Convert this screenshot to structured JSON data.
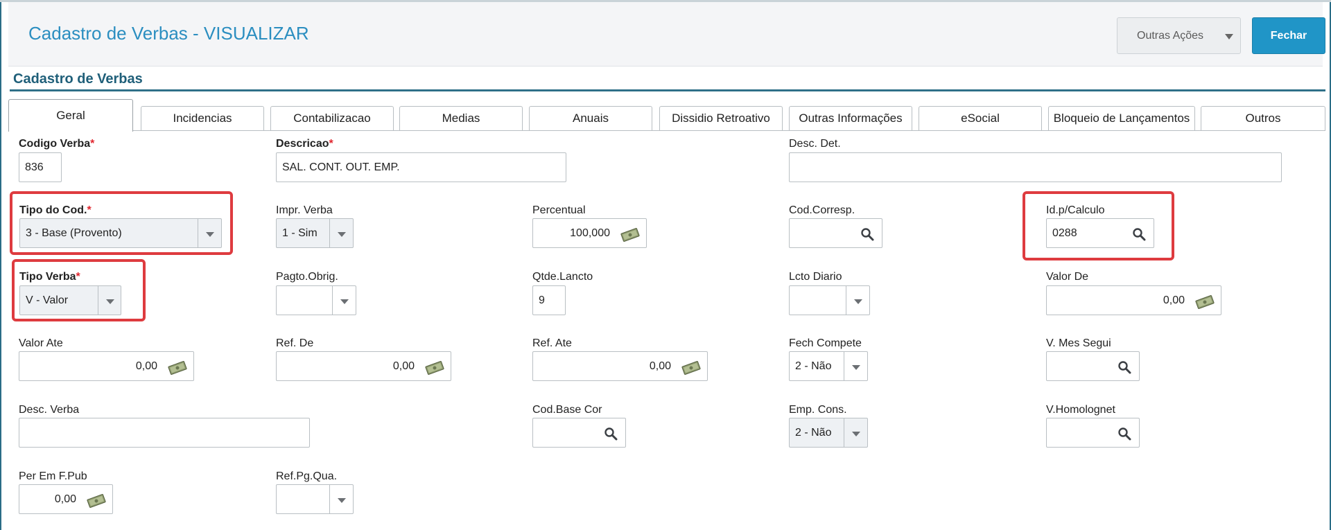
{
  "header": {
    "title": "Cadastro de Verbas - VISUALIZAR",
    "other_actions_label": "Outras Ações",
    "close_label": "Fechar"
  },
  "section": {
    "title": "Cadastro de Verbas"
  },
  "tabs": [
    {
      "label": "Geral",
      "active": true
    },
    {
      "label": "Incidencias"
    },
    {
      "label": "Contabilizacao"
    },
    {
      "label": "Medias"
    },
    {
      "label": "Anuais"
    },
    {
      "label": "Dissidio Retroativo"
    },
    {
      "label": "Outras Informações"
    },
    {
      "label": "eSocial"
    },
    {
      "label": "Bloqueio de Lançamentos"
    },
    {
      "label": "Outros"
    }
  ],
  "form": {
    "codigo_verba": {
      "label": "Codigo Verba",
      "value": "836",
      "required": "*"
    },
    "descricao": {
      "label": "Descricao",
      "value": "SAL. CONT. OUT. EMP.",
      "required": "*"
    },
    "desc_det": {
      "label": "Desc. Det.",
      "value": ""
    },
    "tipo_cod": {
      "label": "Tipo do Cod.",
      "value": "3 - Base (Provento)",
      "required": "*"
    },
    "impr_verba": {
      "label": "Impr. Verba",
      "value": "1 - Sim"
    },
    "percentual": {
      "label": "Percentual",
      "value": "100,000"
    },
    "cod_corresp": {
      "label": "Cod.Corresp.",
      "value": ""
    },
    "id_calculo": {
      "label": "Id.p/Calculo",
      "value": "0288"
    },
    "tipo_verba": {
      "label": "Tipo Verba",
      "value": "V - Valor",
      "required": "*"
    },
    "pagto_obrig": {
      "label": "Pagto.Obrig.",
      "value": ""
    },
    "qtde_lancto": {
      "label": "Qtde.Lancto",
      "value": "9"
    },
    "lcto_diario": {
      "label": "Lcto Diario",
      "value": ""
    },
    "valor_de": {
      "label": "Valor De",
      "value": "0,00"
    },
    "valor_ate": {
      "label": "Valor Ate",
      "value": "0,00"
    },
    "ref_de": {
      "label": "Ref. De",
      "value": "0,00"
    },
    "ref_ate": {
      "label": "Ref. Ate",
      "value": "0,00"
    },
    "fech_compete": {
      "label": "Fech Compete",
      "value": "2 - Não"
    },
    "v_mes_segui": {
      "label": "V. Mes Segui",
      "value": ""
    },
    "desc_verba": {
      "label": "Desc. Verba",
      "value": ""
    },
    "cod_base_cor": {
      "label": "Cod.Base Cor",
      "value": ""
    },
    "emp_cons": {
      "label": "Emp. Cons.",
      "value": "2 - Não"
    },
    "v_homolognet": {
      "label": "V.Homolognet",
      "value": ""
    },
    "per_em_f_pub": {
      "label": "Per Em F.Pub",
      "value": "0,00"
    },
    "ref_pg_qua": {
      "label": "Ref.Pg.Qua.",
      "value": ""
    }
  },
  "colors": {
    "title": "#2b8ec0",
    "primary_button": "#2095c7",
    "section_title": "#1f5f79",
    "highlight": "#de3b3f",
    "required": "#e0262e"
  },
  "icons": {
    "search": "magnifier-icon",
    "money": "money-icon"
  }
}
